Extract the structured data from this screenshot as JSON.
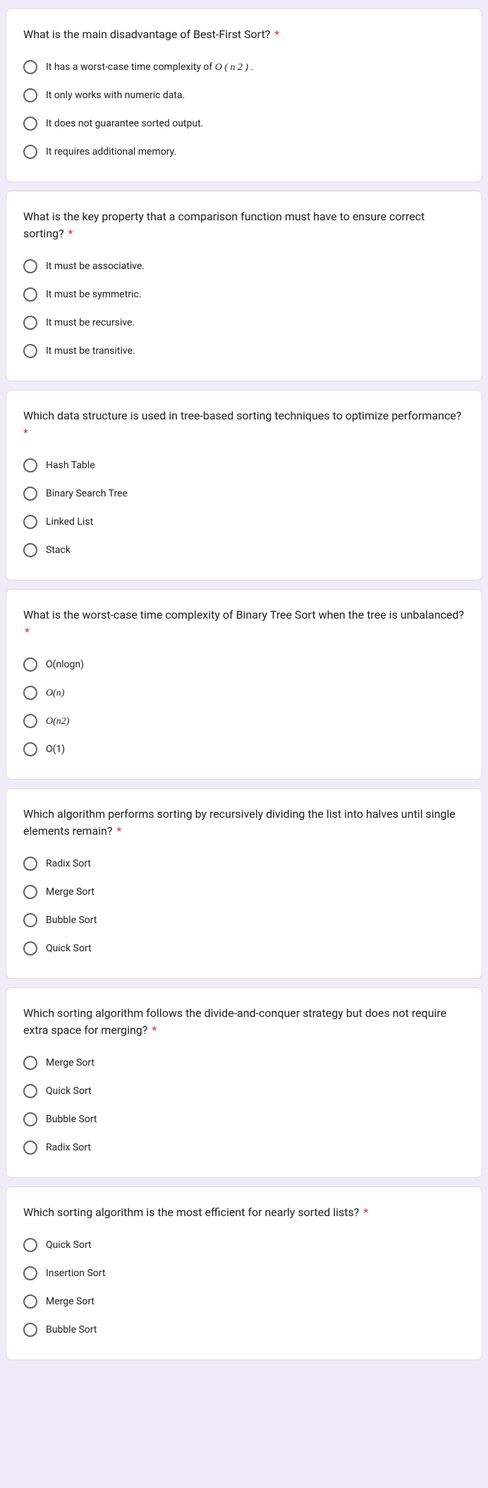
{
  "required_marker": "*",
  "questions": [
    {
      "text": "What is the main disadvantage of Best-First Sort?",
      "required": true,
      "options": [
        {
          "pre": "It has a worst-case time complexity of ",
          "styled": "O ( n 2 )",
          "post": " .",
          "italic": true
        },
        {
          "pre": "It only works with numeric data."
        },
        {
          "pre": "It does not guarantee sorted output."
        },
        {
          "pre": "It requires additional memory."
        }
      ]
    },
    {
      "text": "What is the key property that a comparison function must have to ensure correct sorting?",
      "required": true,
      "options": [
        {
          "pre": "It must be associative."
        },
        {
          "pre": "It must be symmetric."
        },
        {
          "pre": "It must be recursive."
        },
        {
          "pre": "It must be transitive."
        }
      ]
    },
    {
      "text": "Which data structure is used in tree-based sorting techniques to optimize performance?",
      "required": true,
      "options": [
        {
          "pre": "Hash Table"
        },
        {
          "pre": "Binary Search Tree"
        },
        {
          "pre": "Linked List"
        },
        {
          "pre": "Stack"
        }
      ]
    },
    {
      "text": "What is the worst-case time complexity of Binary Tree Sort when the tree is unbalanced?",
      "required": true,
      "options": [
        {
          "pre": "O(nlogn)"
        },
        {
          "styled": "O(n)",
          "italic": true
        },
        {
          "styled": "O(n2)",
          "italic": true
        },
        {
          "pre": "O(1)"
        }
      ]
    },
    {
      "text": "Which algorithm performs sorting by recursively dividing the list into halves until single elements remain?",
      "required": true,
      "options": [
        {
          "pre": "Radix Sort"
        },
        {
          "pre": "Merge Sort"
        },
        {
          "pre": "Bubble Sort"
        },
        {
          "pre": "Quick Sort"
        }
      ]
    },
    {
      "text": "Which sorting algorithm follows the divide-and-conquer strategy but does not require extra space for merging?",
      "required": true,
      "options": [
        {
          "pre": "Merge Sort"
        },
        {
          "pre": "Quick Sort"
        },
        {
          "pre": "Bubble Sort"
        },
        {
          "pre": "Radix Sort"
        }
      ]
    },
    {
      "text": "Which sorting algorithm is the most efficient for nearly sorted lists?",
      "required": true,
      "options": [
        {
          "pre": "Quick Sort"
        },
        {
          "pre": "Insertion Sort"
        },
        {
          "pre": "Merge Sort"
        },
        {
          "pre": "Bubble Sort"
        }
      ]
    }
  ]
}
